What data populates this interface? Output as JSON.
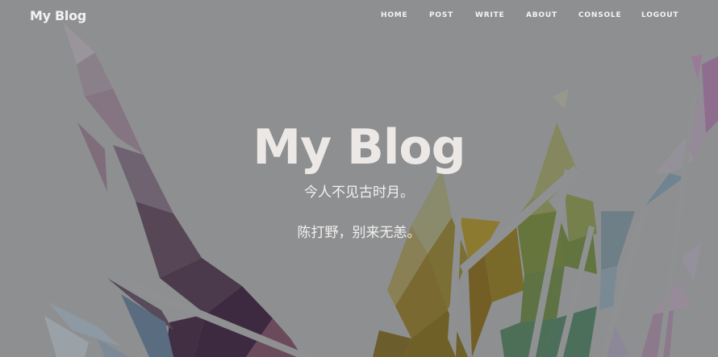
{
  "site": {
    "brand": "My Blog"
  },
  "nav": {
    "home": "HOME",
    "post": "POST",
    "write": "WRITE",
    "about": "ABOUT",
    "console": "CONSOLE",
    "logout": "LOGOUT"
  },
  "hero": {
    "title": "My Blog",
    "subtitle_line1": "今人不见古时月。",
    "subtitle_line2": "陈打野，别来无恙。"
  },
  "colors": {
    "background": "#8e8f91",
    "title": "#ece8e6",
    "nav_text": "#f4f4f4"
  }
}
